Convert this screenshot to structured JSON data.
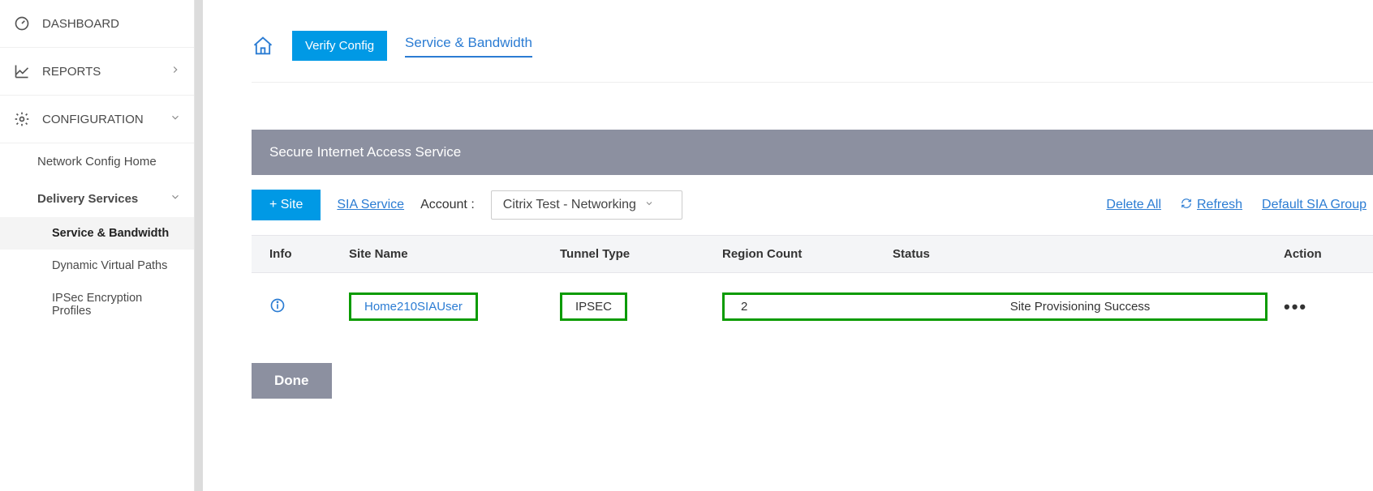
{
  "sidebar": {
    "dashboard": "DASHBOARD",
    "reports": "REPORTS",
    "configuration": "CONFIGURATION",
    "network_config_home": "Network Config Home",
    "delivery_services": "Delivery Services",
    "tree": {
      "service_bandwidth": "Service & Bandwidth",
      "dynamic_virtual_paths": "Dynamic Virtual Paths",
      "ipsec_encryption_profiles": "IPSec Encryption Profiles"
    }
  },
  "crumb": {
    "verify_config": "Verify Config",
    "service_bandwidth": "Service & Bandwidth"
  },
  "panel": {
    "title": "Secure Internet Access Service",
    "add_site": "+ Site",
    "sia_service": "SIA Service",
    "account_label": "Account :",
    "account_value": "Citrix Test - Networking",
    "delete_all": "Delete All",
    "refresh": "Refresh",
    "default_sia_group": "Default SIA Group"
  },
  "table": {
    "headers": {
      "info": "Info",
      "site_name": "Site Name",
      "tunnel_type": "Tunnel Type",
      "region_count": "Region Count",
      "status": "Status",
      "action": "Action"
    },
    "row": {
      "site_name": "Home210SIAUser",
      "tunnel_type": "IPSEC",
      "region_count": "2",
      "status": "Site Provisioning Success",
      "action": "•••"
    }
  },
  "done": "Done"
}
